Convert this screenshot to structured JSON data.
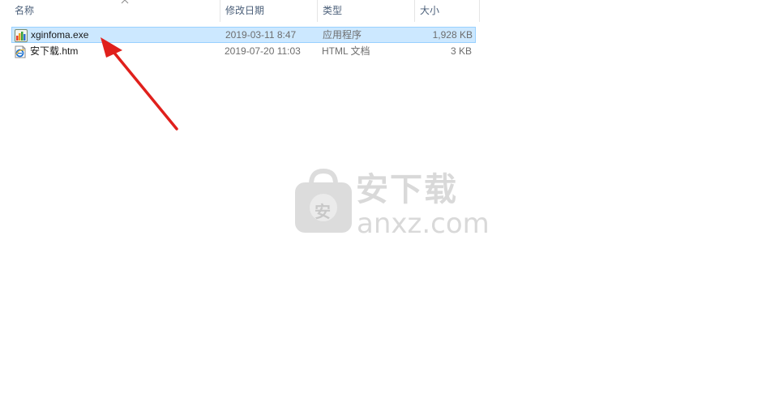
{
  "columns": {
    "name": "名称",
    "modified": "修改日期",
    "type": "类型",
    "size": "大小"
  },
  "files": [
    {
      "name": "xginfoma.exe",
      "modified": "2019-03-11 8:47",
      "type": "应用程序",
      "size": "1,928 KB",
      "icon": "app-exe-icon",
      "selected": true
    },
    {
      "name": "安下载.htm",
      "modified": "2019-07-20 11:03",
      "type": "HTML 文档",
      "size": "3 KB",
      "icon": "ie-html-icon",
      "selected": false
    }
  ],
  "watermark": {
    "badge": "安",
    "title": "安下载",
    "domain": "anxz.com"
  },
  "colors": {
    "selection_fill": "#cce8ff",
    "selection_border": "#99d1ff",
    "arrow": "#e0201c"
  }
}
